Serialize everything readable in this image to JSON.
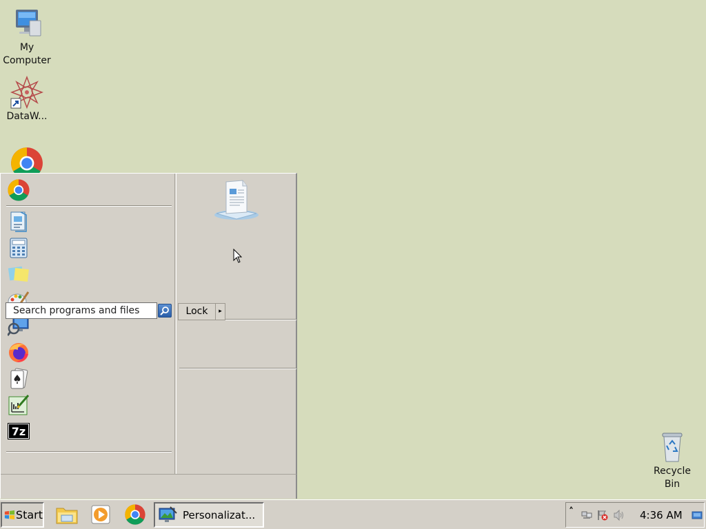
{
  "desktop": {
    "icons": [
      {
        "label": "My\nComputer"
      },
      {
        "label": "DataW..."
      },
      {
        "label": ""
      },
      {
        "label": "Recycle Bin"
      }
    ]
  },
  "start_menu": {
    "pinned": [
      {
        "icon": "chrome-icon"
      }
    ],
    "recent_programs": [
      {
        "icon": "document-viewer-icon"
      },
      {
        "icon": "calculator-icon"
      },
      {
        "icon": "sticky-notes-icon"
      },
      {
        "icon": "paint-icon"
      },
      {
        "icon": "remote-desktop-icon"
      },
      {
        "icon": "firefox-icon"
      },
      {
        "icon": "solitaire-icon"
      },
      {
        "icon": "chart-editor-icon"
      },
      {
        "icon": "7zip-icon"
      }
    ],
    "search_placeholder": "Search programs and files",
    "lock_label": "Lock",
    "lock_arrow": "▸"
  },
  "taskbar": {
    "start_label": "Start",
    "task_button": "Personalizat...",
    "clock": "4:36 AM",
    "tray_chevron": "˄"
  },
  "colors": {
    "desktop_bg": "#d6dcbc",
    "menu_bg": "#d4d0c8"
  }
}
